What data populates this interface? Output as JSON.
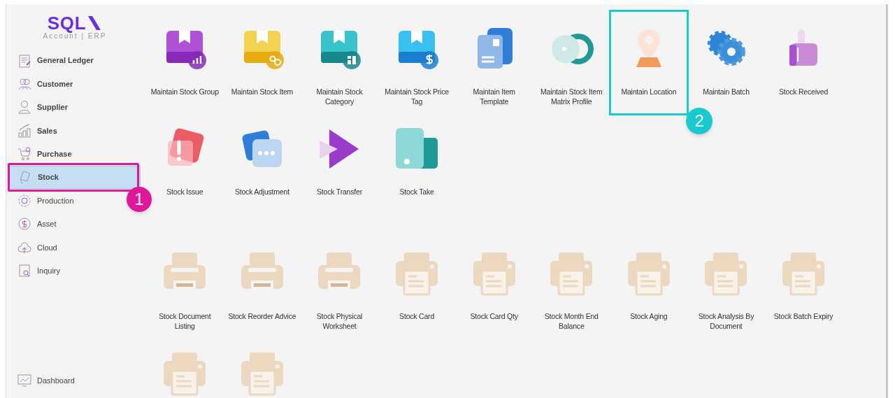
{
  "logo": {
    "text": "SQL",
    "subtitle": "Account | ERP"
  },
  "sidebar": {
    "items": [
      {
        "label": "General Ledger",
        "emphasized": true,
        "selected": false
      },
      {
        "label": "Customer",
        "emphasized": true,
        "selected": false
      },
      {
        "label": "Supplier",
        "emphasized": true,
        "selected": false
      },
      {
        "label": "Sales",
        "emphasized": true,
        "selected": false
      },
      {
        "label": "Purchase",
        "emphasized": true,
        "selected": false
      },
      {
        "label": "Stock",
        "emphasized": true,
        "selected": true,
        "callout": {
          "number": "1",
          "color": "#e0169c"
        }
      },
      {
        "label": "Production",
        "emphasized": false,
        "selected": false
      },
      {
        "label": "Asset",
        "emphasized": false,
        "selected": false
      },
      {
        "label": "Cloud",
        "emphasized": false,
        "selected": false
      },
      {
        "label": "Inquiry",
        "emphasized": false,
        "selected": false
      }
    ],
    "footer": {
      "label": "Dashboard"
    }
  },
  "sections": [
    {
      "tiles": [
        {
          "label": "Maintain Stock Group"
        },
        {
          "label": "Maintain Stock Item"
        },
        {
          "label": "Maintain Stock Category"
        },
        {
          "label": "Maintain Stock Price Tag"
        },
        {
          "label": "Maintain Item Template"
        },
        {
          "label": "Maintain Stock Item Matrix Profile"
        },
        {
          "label": "Maintain Location",
          "callout": {
            "number": "2",
            "color": "#17c9d1"
          }
        },
        {
          "label": "Maintain Batch"
        },
        {
          "label": "Stock Received"
        },
        {
          "label": "Stock Issue"
        },
        {
          "label": "Stock Adjustment"
        },
        {
          "label": "Stock Transfer"
        },
        {
          "label": "Stock Take"
        }
      ]
    },
    {
      "tiles": [
        {
          "label": "Stock Document Listing",
          "kind": "tray"
        },
        {
          "label": "Stock Reorder Advice",
          "kind": "tray"
        },
        {
          "label": "Stock Physical Worksheet",
          "kind": "tray"
        },
        {
          "label": "Stock Card",
          "kind": "sheet"
        },
        {
          "label": "Stock Card Qty",
          "kind": "sheet"
        },
        {
          "label": "Stock Month End Balance",
          "kind": "sheet"
        },
        {
          "label": "Stock Aging",
          "kind": "sheet"
        },
        {
          "label": "Stock Analysis By Document",
          "kind": "sheet"
        },
        {
          "label": "Stock Batch Expiry",
          "kind": "sheet"
        },
        {
          "kind": "sheet"
        },
        {
          "kind": "sheet"
        }
      ]
    }
  ]
}
